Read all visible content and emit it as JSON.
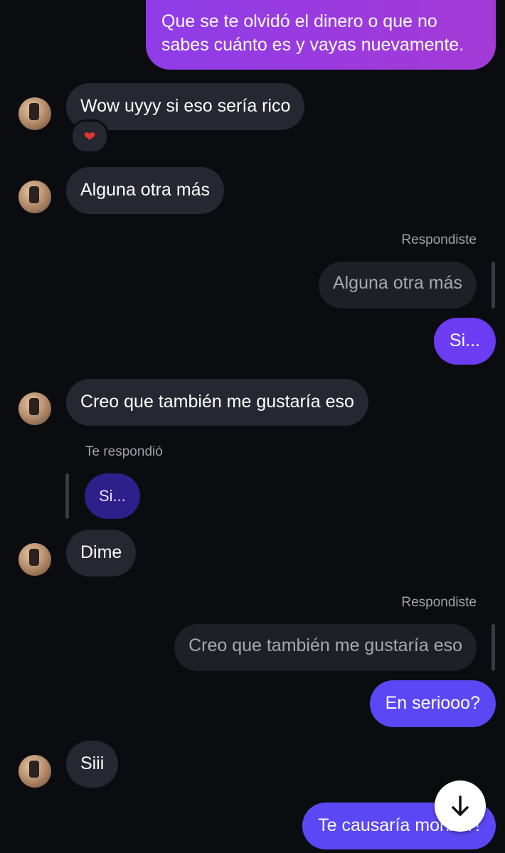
{
  "messages": [
    {
      "id": "m1",
      "side": "out",
      "text_lines": [
        "Que se te olvidó el dinero o que no",
        "sabes cuánto es y vayas nuevamente."
      ]
    },
    {
      "id": "m2",
      "side": "in",
      "text": "Wow uyyy si eso sería rico",
      "reaction": "heart"
    },
    {
      "id": "m3",
      "side": "in",
      "text": "Alguna otra más"
    },
    {
      "id": "m4",
      "side": "out",
      "reply_label": "Respondiste",
      "quoted": "Alguna otra más",
      "text": "Si..."
    },
    {
      "id": "m5",
      "side": "in",
      "text": "Creo que también me gustaría eso"
    },
    {
      "id": "m6",
      "side": "in",
      "reply_label": "Te respondió",
      "quoted": "Si...",
      "text": "Dime"
    },
    {
      "id": "m7",
      "side": "out",
      "reply_label": "Respondiste",
      "quoted": "Creo que también me gustaría eso",
      "text": "En seriooo?"
    },
    {
      "id": "m8",
      "side": "in",
      "text": "Siii"
    },
    {
      "id": "m9",
      "side": "out",
      "text": "Te causaría morbo?!"
    }
  ],
  "reaction_glyph": "❤",
  "scroll_button_icon": "arrow-down-icon",
  "colors": {
    "background": "#0b0c10",
    "incoming_bubble": "#262730",
    "outgoing_magenta": "#a43ad6",
    "outgoing_violet": "#6b3cf2",
    "outgoing_blue": "#5b48f4",
    "quoted_bubble": "#1f2026",
    "meta_text": "#a3a4aa"
  }
}
